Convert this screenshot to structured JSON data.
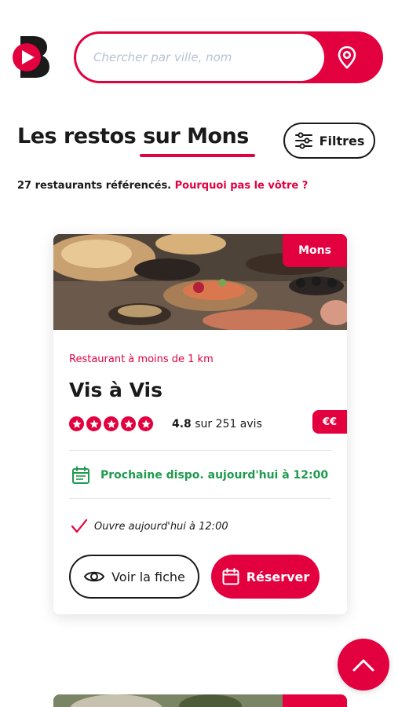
{
  "header": {
    "logo_icon": "brand-b-play-logo",
    "search": {
      "placeholder": "Chercher par ville, nom",
      "value": "",
      "action_icon": "location-pin-icon"
    }
  },
  "page": {
    "title": "Les restos sur Mons",
    "filters_label": "Filtres",
    "count_text": "27 restaurants référencés.",
    "count_link": "Pourquoi pas le vôtre ?"
  },
  "restaurant": {
    "city": "Mons",
    "distance": "Restaurant à moins de 1 km",
    "name": "Vis à Vis",
    "rating_value": "4.8",
    "rating_text": "sur 251 avis",
    "stars": 5,
    "price": "€€",
    "next_availability": "Prochaine dispo. aujourd'hui à 12:00",
    "opens": "Ouvre aujourd'hui à 12:00",
    "view_label": "Voir la fiche",
    "book_label": "Réserver"
  },
  "colors": {
    "accent": "#e3003f",
    "available": "#1f9a4e",
    "text": "#1a1a1a"
  }
}
